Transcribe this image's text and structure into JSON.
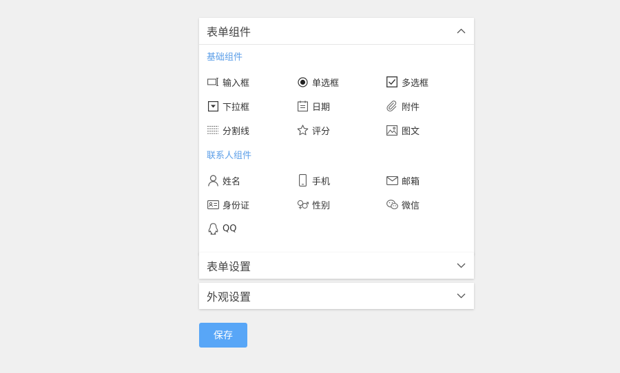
{
  "panels": {
    "form_components": {
      "title": "表单组件",
      "expanded": true,
      "groups": {
        "basic": {
          "title": "基础组件",
          "items": [
            "输入框",
            "单选框",
            "多选框",
            "下拉框",
            "日期",
            "附件",
            "分割线",
            "评分",
            "图文"
          ]
        },
        "contact": {
          "title": "联系人组件",
          "items": [
            "姓名",
            "手机",
            "邮箱",
            "身份证",
            "性别",
            "微信",
            "QQ"
          ]
        }
      }
    },
    "form_settings": {
      "title": "表单设置",
      "expanded": false
    },
    "appearance_settings": {
      "title": "外观设置",
      "expanded": false
    }
  },
  "save_button": {
    "label": "保存"
  },
  "colors": {
    "accent": "#58a6f7",
    "group_title": "#5b9ee8",
    "background": "#f0f0f0"
  }
}
